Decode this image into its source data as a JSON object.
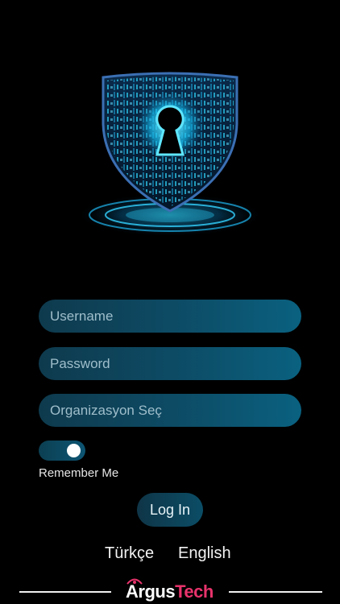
{
  "emblem": {
    "name": "shield-lock",
    "glow_color": "#17c8f0"
  },
  "form": {
    "username_placeholder": "Username",
    "password_placeholder": "Password",
    "organization_placeholder": "Organizasyon Seç",
    "remember_label": "Remember Me",
    "remember_on": true,
    "login_label": "Log In"
  },
  "languages": {
    "turkish": "Türkçe",
    "english": "English"
  },
  "brand": {
    "part1": "Argus",
    "part2": "Tech",
    "accent_color": "#e8336c"
  }
}
